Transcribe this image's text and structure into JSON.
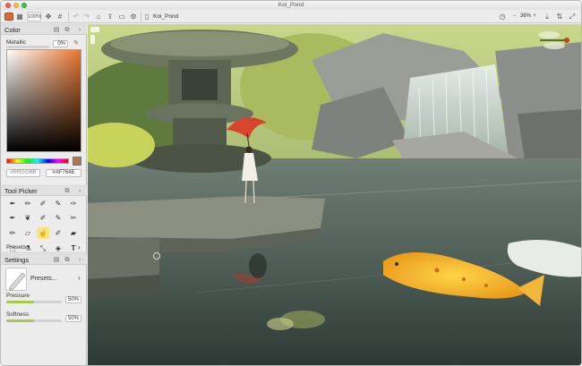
{
  "window": {
    "title": "Koi_Pond"
  },
  "toolbar": {
    "zoom_left": "100%",
    "document_name": "Koi_Pond",
    "zoom_right": "36%"
  },
  "color_panel": {
    "title": "Color",
    "metallic_label": "Metallic",
    "metallic_value": "0%",
    "metallic_level": 0,
    "hex_placeholder": "#RRGGBB",
    "hex_value": "#AF764E",
    "current_color": "#af764e"
  },
  "tool_picker": {
    "title": "Tool Picker",
    "presets_label": "Presets..."
  },
  "settings": {
    "title": "Settings",
    "presets_label": "Presets...",
    "pressure_label": "Pressure",
    "pressure_value": "50%",
    "pressure_level": 0.5,
    "softness_label": "Softness",
    "softness_value": "50%",
    "softness_level": 0.5
  },
  "colors": {
    "accent_active_tool": "#f4e57e",
    "slider_fill": "#a9c94a"
  }
}
